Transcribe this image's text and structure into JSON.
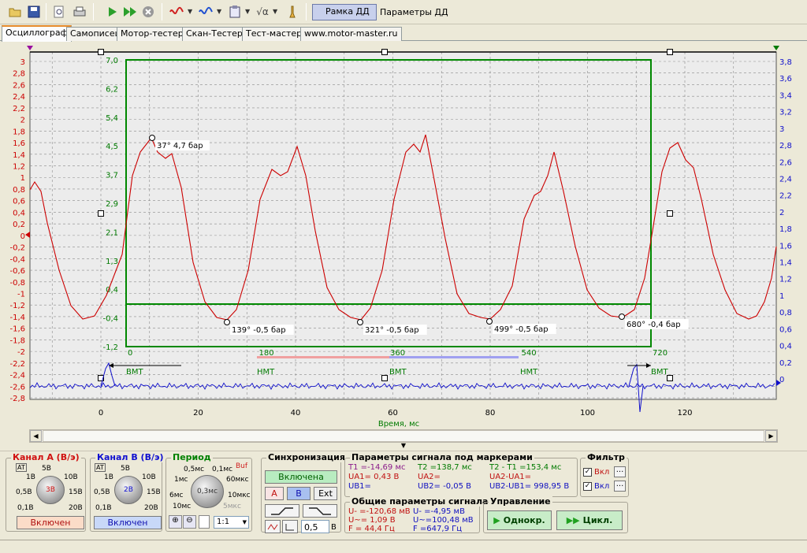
{
  "toolbar": {
    "frame_toggle_label": "Рамка ДД",
    "params_label": "Параметры ДД",
    "icons": [
      "open-folder-icon",
      "save-icon",
      "zoom-doc-icon",
      "print-icon",
      "play-icon",
      "fast-play-icon",
      "stop-icon",
      "signal-red-icon",
      "signal-blue-icon",
      "clipboard-icon",
      "math-icon",
      "probe-icon"
    ]
  },
  "tabs": [
    "Осциллограф",
    "Самописец",
    "Мотор-тестер",
    "Скан-Тестер",
    "Тест-мастер",
    "www.motor-master.ru"
  ],
  "active_tab": 0,
  "colors": {
    "channel_a": "#cc0000",
    "channel_b": "#1010cc",
    "frame": "#008800",
    "grid": "#8a8a8a"
  },
  "axes": {
    "left_ticks": [
      "3",
      "2,8",
      "2,6",
      "2,4",
      "2,2",
      "2",
      "1,8",
      "1,6",
      "1,4",
      "1,2",
      "1",
      "0,8",
      "0,6",
      "0,4",
      "0,2",
      "0",
      "-0,2",
      "-0,4",
      "-0,6",
      "-0,8",
      "-1",
      "-1,2",
      "-1,4",
      "-1,6",
      "-1,8",
      "-2",
      "-2,2",
      "-2,4",
      "-2,6",
      "-2,8"
    ],
    "right_ticks": [
      "3,8",
      "3,6",
      "3,4",
      "3,2",
      "3",
      "2,8",
      "2,6",
      "2,4",
      "2,2",
      "2",
      "1,8",
      "1,6",
      "1,4",
      "1,2",
      "1",
      "0,8",
      "0,6",
      "0,4",
      "0,2",
      "0"
    ],
    "x_ticks": [
      "0",
      "20",
      "40",
      "60",
      "80",
      "100",
      "120"
    ],
    "x_label": "Время, мс"
  },
  "pressure_frame": {
    "y_ticks": [
      "7,0",
      "6,2",
      "5,4",
      "4,5",
      "3,7",
      "2,9",
      "2,1",
      "1,3",
      "0,4",
      "-0,4",
      "-1,2"
    ],
    "x_ticks": [
      "0",
      "180",
      "360",
      "540",
      "720"
    ],
    "markers": [
      "37° 4,7 бар",
      "139° -0,5 бар",
      "321° -0,5 бар",
      "499° -0,5 бар",
      "680° -0,4 бар"
    ],
    "tdc_labels": [
      "ВМТ",
      "НМТ",
      "ВМТ",
      "НМТ",
      "ВМТ"
    ]
  },
  "channel_a": {
    "title": "Канал А (В/э)",
    "value": "3В",
    "knob_labels": [
      "5В",
      "1В",
      "10В",
      "0,5В",
      "15В",
      "0,1В",
      "20В"
    ],
    "state": "Включен"
  },
  "channel_b": {
    "title": "Канал В (В/э)",
    "value": "2В",
    "knob_labels": [
      "5В",
      "1В",
      "10В",
      "0,5В",
      "15В",
      "0,1В",
      "20В"
    ],
    "state": "Включен"
  },
  "period": {
    "title": "Период",
    "buf": "Buf",
    "value": "0,3мс",
    "knob_labels": [
      "0,5мс",
      "0,1мс",
      "1мс",
      "60мкс",
      "6мс",
      "10мкс",
      "10мс",
      "5мкс"
    ],
    "ratio": "1:1"
  },
  "sync": {
    "title": "Синхронизация",
    "state": "Включена",
    "channels": [
      "A",
      "B",
      "Ext"
    ],
    "level": "0,5",
    "unit": "В"
  },
  "markers_params": {
    "title": "Параметры сигнала под маркерами",
    "t1": "T1 =-14,69 мс",
    "t2": "T2 =138,7 мс",
    "dt": "T2 - T1 =153,4 мс",
    "ua1": "UA1= 0,43 В",
    "ua2": "UA2=",
    "dua": "UA2-UA1=",
    "ub1": "UB1=",
    "ub2": "UB2= -0,05 В",
    "dub": "UB2-UB1= 998,95 В"
  },
  "common_params": {
    "title": "Общие параметры сигнала",
    "a_min": "U- =-120,68 мВ",
    "a_max": "U~= 1,09 В",
    "a_f": "F = 44,4 Гц",
    "b_min": "U- =-4,95 мВ",
    "b_max": "U~=100,48 мВ",
    "b_f": "F =647,9 Гц"
  },
  "filter": {
    "title": "Фильтр",
    "a_label": "Вкл",
    "b_label": "Вкл",
    "more": "..."
  },
  "control": {
    "title": "Управление",
    "single": "Однокр.",
    "cycle": "Цикл."
  }
}
